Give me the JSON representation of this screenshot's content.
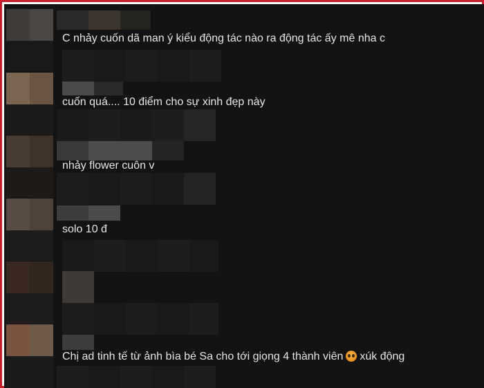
{
  "comments": [
    {
      "text": "C nhảy cuốn dã man ý kiểu động tác nào ra động tác ấy mê nha c"
    },
    {
      "text": "cuốn quá.... 10 điểm cho sự xinh đẹp này"
    },
    {
      "text": "nhảy flower cuôn v"
    },
    {
      "text": "solo 10 đ"
    },
    {
      "text_before": "Chị ad tinh tế từ ảnh bìa bé Sa cho tới giọng 4 thành viên",
      "emoji": "pleading-face-emoji",
      "text_after": "xúk động"
    }
  ],
  "colors": {
    "frame_border": "#c8202a",
    "background": "#131313",
    "text": "#e6e6e6"
  }
}
